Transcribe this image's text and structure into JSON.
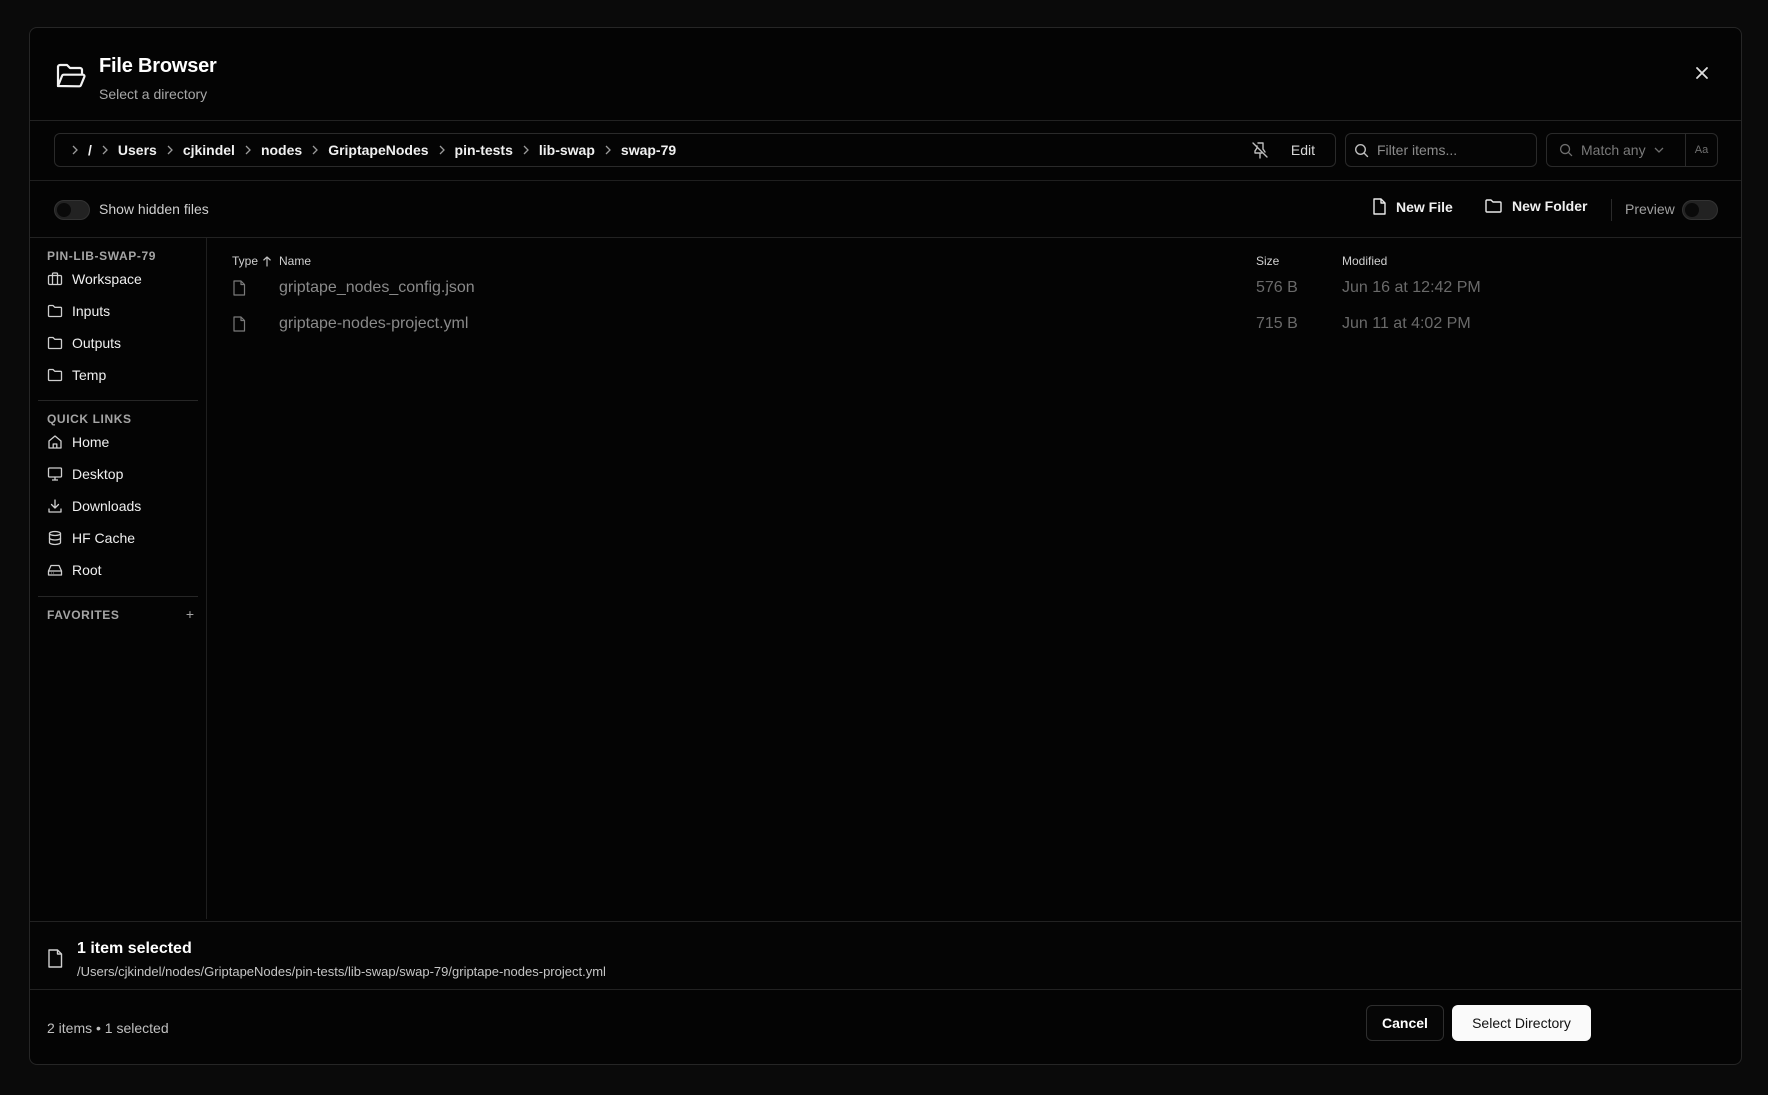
{
  "header": {
    "title": "File Browser",
    "subtitle": "Select a directory",
    "icon": "folder-open-icon"
  },
  "path": {
    "root": "/",
    "segments": [
      "Users",
      "cjkindel",
      "nodes",
      "GriptapeNodes",
      "pin-tests",
      "lib-swap",
      "swap-79"
    ],
    "edit_label": "Edit"
  },
  "filter": {
    "placeholder": "Filter items...",
    "value": "",
    "match_mode": "Match any",
    "case_label": "Aa"
  },
  "toolbar": {
    "show_hidden_label": "Show hidden files",
    "show_hidden": false,
    "new_file_label": "New File",
    "new_folder_label": "New Folder",
    "preview_label": "Preview",
    "preview": false
  },
  "sidebar": {
    "project_title": "PIN-LIB-SWAP-79",
    "project_items": [
      {
        "label": "Workspace",
        "icon": "briefcase-icon"
      },
      {
        "label": "Inputs",
        "icon": "folder-icon"
      },
      {
        "label": "Outputs",
        "icon": "folder-icon"
      },
      {
        "label": "Temp",
        "icon": "folder-icon"
      }
    ],
    "quick_title": "QUICK LINKS",
    "quick_items": [
      {
        "label": "Home",
        "icon": "home-icon"
      },
      {
        "label": "Desktop",
        "icon": "monitor-icon"
      },
      {
        "label": "Downloads",
        "icon": "download-icon"
      },
      {
        "label": "HF Cache",
        "icon": "database-icon"
      },
      {
        "label": "Root",
        "icon": "hard-drive-icon"
      }
    ],
    "favorites_title": "FAVORITES",
    "favorites_add": "+"
  },
  "table": {
    "columns": {
      "type": "Type",
      "name": "Name",
      "size": "Size",
      "modified": "Modified"
    },
    "sort": "type-ascending",
    "rows": [
      {
        "name": "griptape_nodes_config.json",
        "size": "576 B",
        "modified": "Jun 16 at 12:42 PM"
      },
      {
        "name": "griptape-nodes-project.yml",
        "size": "715 B",
        "modified": "Jun 11 at 4:02 PM"
      }
    ]
  },
  "selection": {
    "title": "1 item selected",
    "path": "/Users/cjkindel/nodes/GriptapeNodes/pin-tests/lib-swap/swap-79/griptape-nodes-project.yml"
  },
  "footer": {
    "count": "2 items • 1 selected",
    "cancel_label": "Cancel",
    "select_label": "Select Directory"
  },
  "colors": {
    "background": "#0a0a0a",
    "dialog": "#040404",
    "border": "#262626",
    "primary_button": "#fafafa"
  }
}
